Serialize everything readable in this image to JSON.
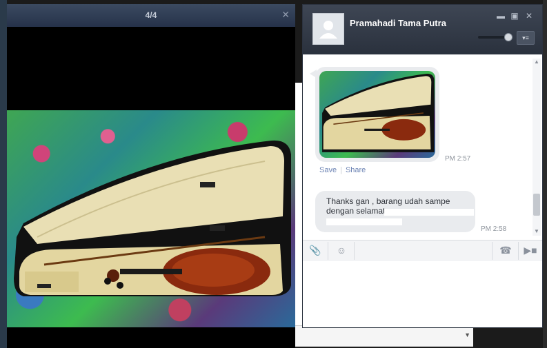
{
  "viewer": {
    "counter": "4/4",
    "close_icon": "close-icon"
  },
  "chat": {
    "contact_name": "Pramahadi Tama Putra",
    "minimize_icon": "minimize-icon",
    "maximize_icon": "maximize-icon",
    "close_icon": "close-icon",
    "volume_level": 0.9,
    "options_icon": "options-menu-icon",
    "messages": [
      {
        "type": "image",
        "time": "PM 2:57",
        "actions": [
          "Save",
          "Share"
        ]
      },
      {
        "type": "text",
        "text_line1": "Thanks gan , barang udah sampe",
        "text_line2": "dengan selamat",
        "time": "PM 2:58"
      }
    ],
    "toolbar": {
      "attach_icon": "paperclip-icon",
      "emoji_icon": "emoji-icon",
      "call_icon": "phone-icon",
      "video_icon": "video-icon"
    }
  },
  "colors": {
    "header_dark": "#2a313d",
    "bubble": "#e9ebee",
    "link": "#6d84b4"
  }
}
